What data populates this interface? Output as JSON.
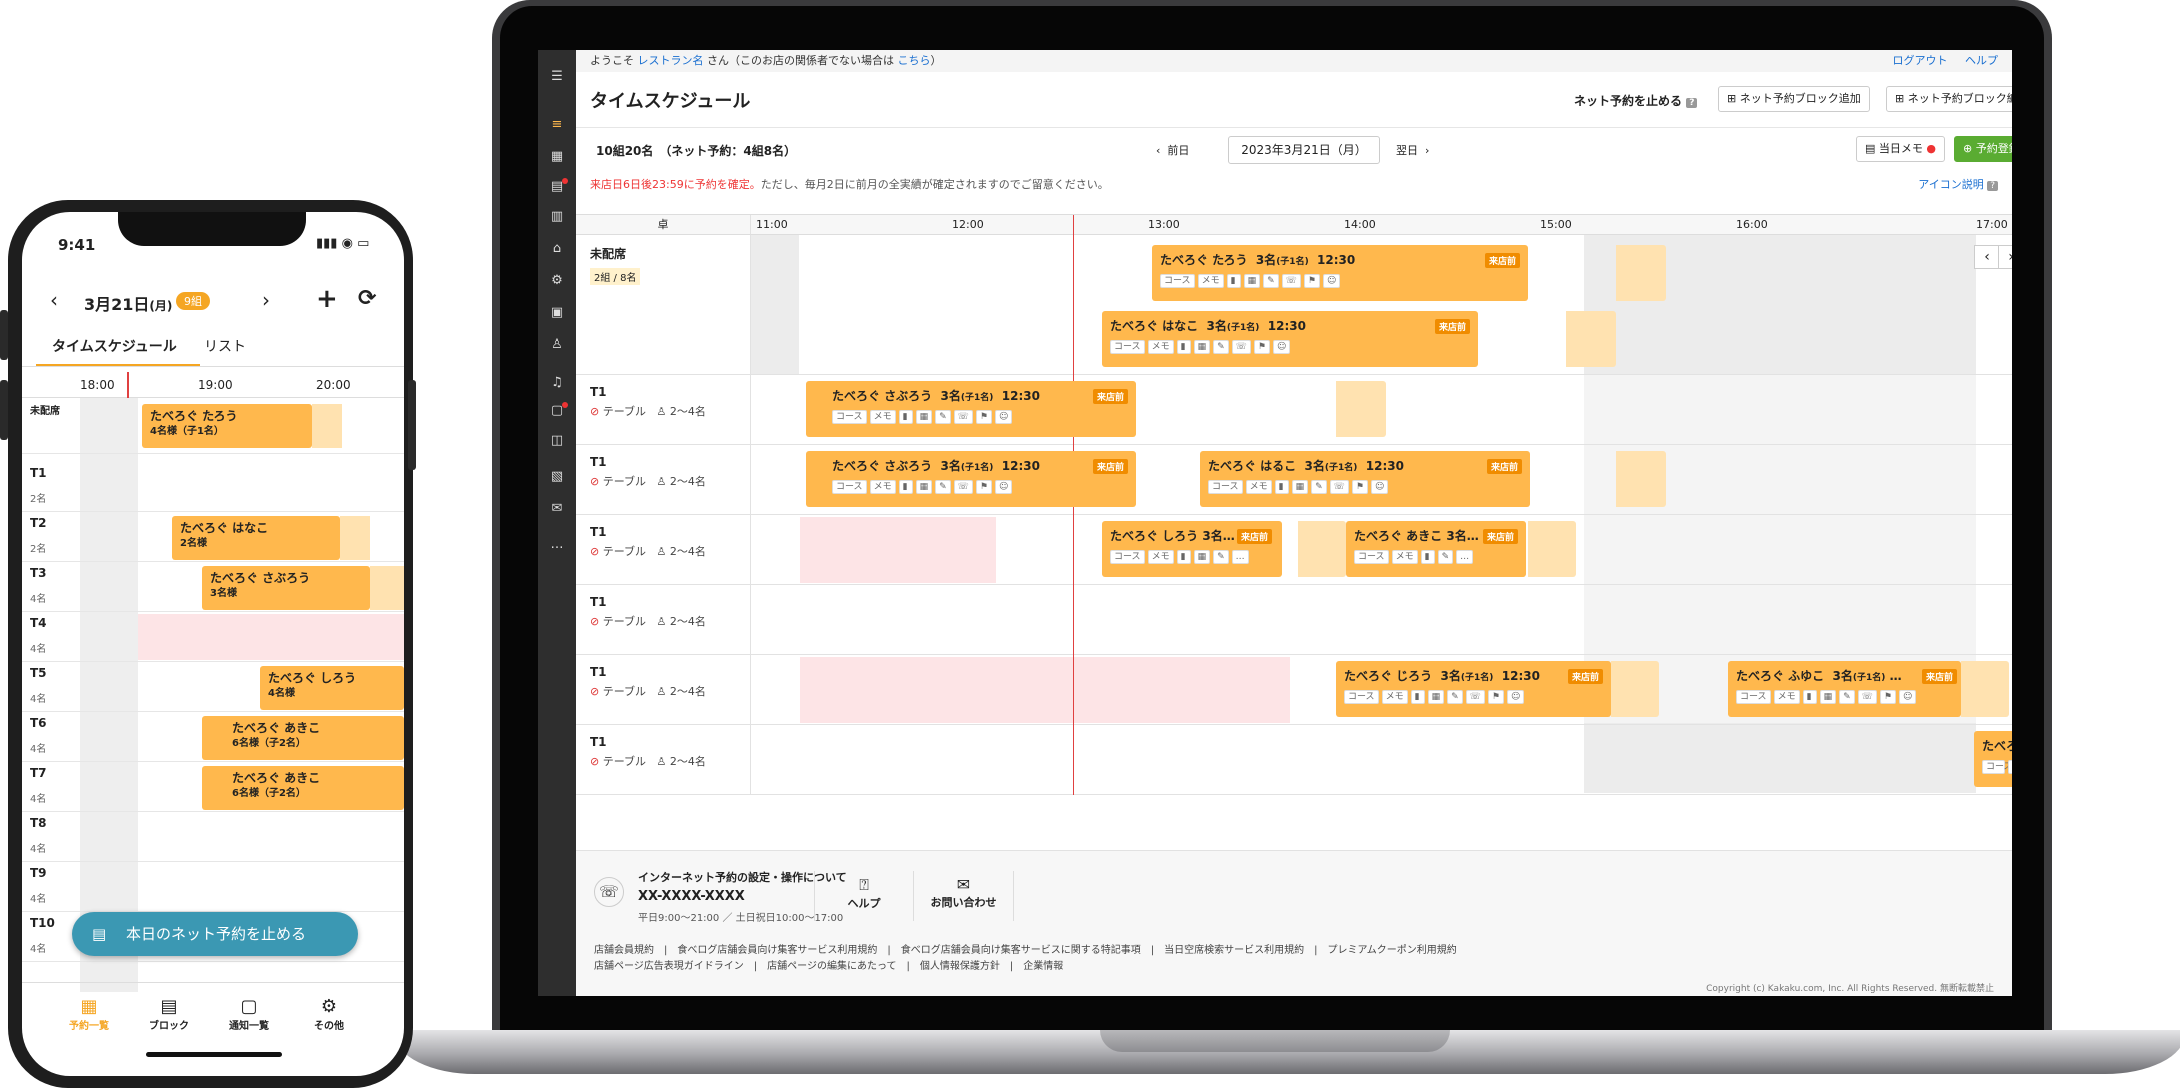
{
  "laptop": {
    "topbar": {
      "welcome_prefix": "ようこそ",
      "restaurant_name": "レストラン名",
      "welcome_suffix": "さん（このお店の関係者でない場合は",
      "here_link": "こちら",
      "welcome_close": "）",
      "logout": "ログアウト",
      "help": "ヘルプ"
    },
    "title": "タイムスケジュール",
    "stop_net": "ネット予約を止める",
    "add_block": "ネット予約ブロック追加",
    "edit_block": "ネット予約ブロック編集",
    "summary": "10組20名　（ネット予約：4組8名）",
    "prev_day": "前日",
    "date": "2023年3月21日（月）",
    "next_day": "翌日",
    "today_memo": "当日メモ",
    "register": "予約登録",
    "notice_red": "来店日6日後23:59に予約を確定。",
    "notice_rest": "ただし、毎月2日に前月の全実績が確定されますのでご留意ください。",
    "icon_legend": "アイコン説明",
    "seat_header": "卓",
    "hours": [
      "11:00",
      "12:00",
      "13:00",
      "14:00",
      "15:00",
      "16:00",
      "17:00"
    ],
    "unassigned": {
      "label": "未配席",
      "count": "2組 / 8名"
    },
    "table_type": "テーブル",
    "capacity": "2〜4名",
    "tables": [
      "T1",
      "T1",
      "T1",
      "T1",
      "T1",
      "T1"
    ],
    "chip_labels": [
      "コース",
      "メモ"
    ],
    "arrive_badge": "来店前",
    "reservations": [
      {
        "name": "たべろぐ たろう",
        "people": "3名",
        "kids": "(子1名)",
        "time": "12:30"
      },
      {
        "name": "たべろぐ はなこ",
        "people": "3名",
        "kids": "(子1名)",
        "time": "12:30"
      },
      {
        "name": "たべろぐ さぶろう",
        "people": "3名",
        "kids": "(子1名)",
        "time": "12:30"
      },
      {
        "name": "たべろぐ さぶろう",
        "people": "3名",
        "kids": "(子1名)",
        "time": "12:30"
      },
      {
        "name": "たべろぐ はるこ",
        "people": "3名",
        "kids": "(子1名)",
        "time": "12:30"
      },
      {
        "name": "たべろぐ しろう",
        "people": "3名…",
        "kids": "",
        "time": ""
      },
      {
        "name": "たべろぐ あきこ",
        "people": "3名…",
        "kids": "",
        "time": ""
      },
      {
        "name": "たべろぐ じろう",
        "people": "3名",
        "kids": "(子1名)",
        "time": "12:30"
      },
      {
        "name": "たべろぐ ふゆこ",
        "people": "3名",
        "kids": "(子1名)",
        "time": "…"
      },
      {
        "name": "たべろぐ ごろ",
        "people": "",
        "kids": "",
        "time": ""
      }
    ],
    "footer": {
      "contact_title": "インターネット予約の設定・操作について",
      "phone": "XX-XXXX-XXXX",
      "hours": "平日9:00〜21:00 ／ 土日祝日10:00〜17:00",
      "help": "ヘルプ",
      "inquiry": "お問い合わせ",
      "links1": "店舗会員規約　|　食べログ店舗会員向け集客サービス利用規約　|　食べログ店舗会員向け集客サービスに関する特記事項　|　当日空席検索サービス利用規約　|　プレミアムクーポン利用規約",
      "links2": "店舗ページ広告表現ガイドライン　|　店舗ページの編集にあたって　|　個人情報保護方針　|　企業情報",
      "copyright": "Copyright (c) Kakaku.com, Inc. All Rights Reserved. 無断転載禁止"
    }
  },
  "phone": {
    "time": "9:41",
    "date": "3月21日",
    "weekday": "(月)",
    "count_badge": "9組",
    "tab_schedule": "タイムスケジュール",
    "tab_list": "リスト",
    "hours": [
      "18:00",
      "19:00",
      "20:00"
    ],
    "unassigned": "未配席",
    "rows": [
      {
        "t": "T1",
        "s": "2名"
      },
      {
        "t": "T2",
        "s": "2名"
      },
      {
        "t": "T3",
        "s": "4名"
      },
      {
        "t": "T4",
        "s": "4名"
      },
      {
        "t": "T5",
        "s": "4名"
      },
      {
        "t": "T6",
        "s": "4名"
      },
      {
        "t": "T7",
        "s": "4名"
      },
      {
        "t": "T8",
        "s": "4名"
      },
      {
        "t": "T9",
        "s": "4名"
      },
      {
        "t": "T10",
        "s": "4名"
      }
    ],
    "res": [
      {
        "name": "たべろぐ たろう",
        "sub": "4名様（子1名）"
      },
      {
        "name": "たべろぐ はなこ",
        "sub": "2名様"
      },
      {
        "name": "たべろぐ さぶろう",
        "sub": "3名様"
      },
      {
        "name": "たべろぐ しろう",
        "sub": "4名様"
      },
      {
        "name": "たべろぐ あきこ",
        "sub": "6名様（子2名）"
      },
      {
        "name": "たべろぐ あきこ",
        "sub": "6名様（子2名）"
      }
    ],
    "stop_button": "本日のネット予約を止める",
    "nav": [
      "予約一覧",
      "ブロック",
      "通知一覧",
      "その他"
    ]
  }
}
